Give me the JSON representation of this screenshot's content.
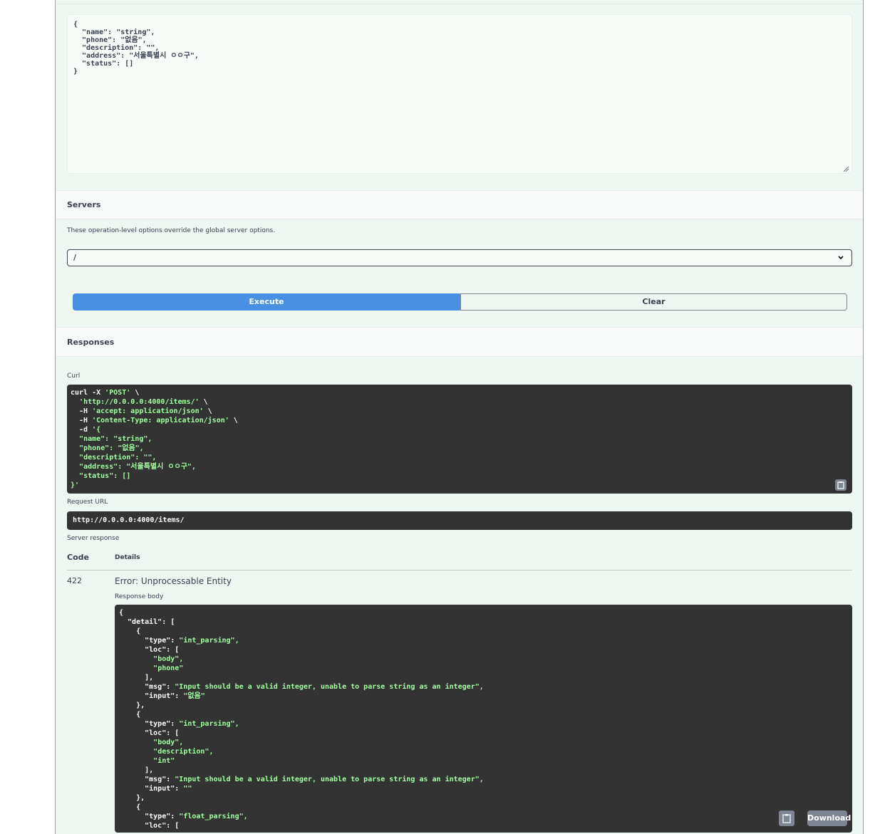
{
  "request_body": {
    "lines": [
      "{",
      "  \"name\": \"string\",",
      "  \"phone\": \"없음\",",
      "  \"description\": \"\",",
      "  \"address\": \"서울특별시 ㅇㅇ구\",",
      "  \"status\": []",
      "}"
    ]
  },
  "servers": {
    "title": "Servers",
    "note": "These operation-level options override the global server options.",
    "selected": "/"
  },
  "actions": {
    "execute": "Execute",
    "clear": "Clear"
  },
  "responses": {
    "title": "Responses",
    "curl_label": "Curl",
    "curl_lines": [
      [
        "curl -X ",
        "'POST'",
        " \\"
      ],
      [
        "  ",
        "'http://0.0.0.0:4000/items/'",
        " \\"
      ],
      [
        "  -H ",
        "'accept: application/json'",
        " \\"
      ],
      [
        "  -H ",
        "'Content-Type: application/json'",
        " \\"
      ],
      [
        "  -d ",
        "'{",
        ""
      ],
      [
        "  ",
        "\"name\": \"string\",",
        ""
      ],
      [
        "  ",
        "\"phone\": \"없음\",",
        ""
      ],
      [
        "  ",
        "\"description\": \"\",",
        ""
      ],
      [
        "  ",
        "\"address\": \"서울특별시 ㅇㅇ구\",",
        ""
      ],
      [
        "  ",
        "\"status\": []",
        ""
      ],
      [
        "",
        "}'",
        ""
      ]
    ],
    "request_url_label": "Request URL",
    "request_url": "http://0.0.0.0:4000/items/",
    "server_response_label": "Server response",
    "col_code": "Code",
    "col_details": "Details",
    "code": "422",
    "status_text": "Error: Unprocessable Entity",
    "response_body_label": "Response body",
    "response_lines": [
      [
        "{",
        ""
      ],
      [
        "  \"detail\": [",
        ""
      ],
      [
        "    {",
        ""
      ],
      [
        "      \"type\": ",
        "\"int_parsing\","
      ],
      [
        "      \"loc\": [",
        ""
      ],
      [
        "        ",
        "\"body\","
      ],
      [
        "        ",
        "\"phone\""
      ],
      [
        "      ],",
        ""
      ],
      [
        "      \"msg\": ",
        "\"Input should be a valid integer, unable to parse string as an integer\","
      ],
      [
        "      \"input\": ",
        "\"없음\""
      ],
      [
        "    },",
        ""
      ],
      [
        "    {",
        ""
      ],
      [
        "      \"type\": ",
        "\"int_parsing\","
      ],
      [
        "      \"loc\": [",
        ""
      ],
      [
        "        ",
        "\"body\","
      ],
      [
        "        ",
        "\"description\","
      ],
      [
        "        ",
        "\"int\""
      ],
      [
        "      ],",
        ""
      ],
      [
        "      \"msg\": ",
        "\"Input should be a valid integer, unable to parse string as an integer\","
      ],
      [
        "      \"input\": ",
        "\"\""
      ],
      [
        "    },",
        ""
      ],
      [
        "    {",
        ""
      ],
      [
        "      \"type\": ",
        "\"float_parsing\","
      ],
      [
        "      \"loc\": [",
        ""
      ]
    ],
    "download_label": "Download"
  },
  "icons": {
    "copy": "clipboard-icon",
    "select": "chevron-down-icon",
    "resize": "resize-grip-icon"
  }
}
